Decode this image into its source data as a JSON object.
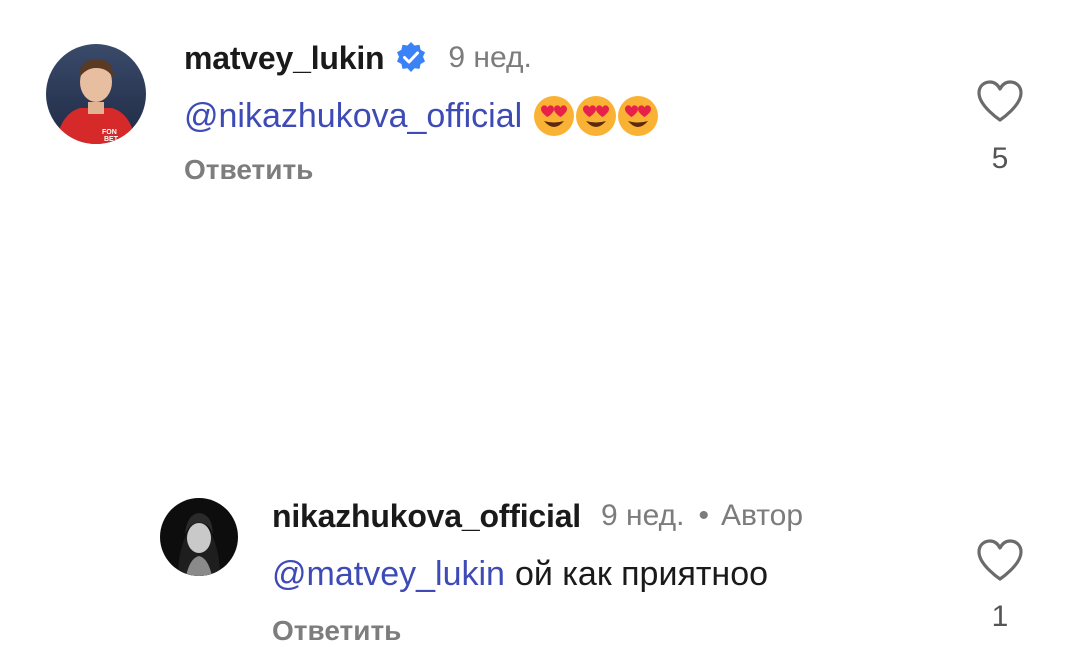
{
  "comments": [
    {
      "username": "matvey_lukin",
      "verified": true,
      "time": "9 нед.",
      "mention": "@nikazhukova_official",
      "text": "",
      "emojis": [
        "heart-eyes-emoji",
        "heart-eyes-emoji",
        "heart-eyes-emoji"
      ],
      "reply_label": "Ответить",
      "likes": "5"
    },
    {
      "username": "nikazhukova_official",
      "verified": false,
      "time": "9 нед.",
      "separator": "•",
      "author_label": "Автор",
      "mention": "@matvey_lukin",
      "text": "ой как приятноо",
      "reply_label": "Ответить",
      "likes": "1"
    }
  ],
  "colors": {
    "mention": "#3e4bb6",
    "muted": "#7c7c7c",
    "verified_badge": "#3b82f6"
  }
}
